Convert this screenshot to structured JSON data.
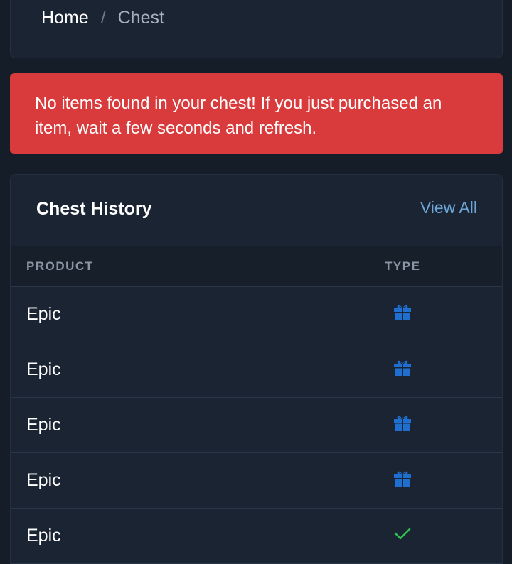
{
  "breadcrumb": {
    "home": "Home",
    "separator": "/",
    "current": "Chest"
  },
  "alert": {
    "message": "No items found in your chest! If you just purchased an item, wait a few seconds and refresh.",
    "color": "#d93a3b"
  },
  "history": {
    "title": "Chest History",
    "view_all": "View All",
    "columns": [
      "PRODUCT",
      "TYPE"
    ],
    "rows": [
      {
        "product": "Epic",
        "type_icon": "gift-icon"
      },
      {
        "product": "Epic",
        "type_icon": "gift-icon"
      },
      {
        "product": "Epic",
        "type_icon": "gift-icon"
      },
      {
        "product": "Epic",
        "type_icon": "gift-icon"
      },
      {
        "product": "Epic",
        "type_icon": "check-icon"
      }
    ]
  },
  "colors": {
    "gift": "#1e6fd0",
    "check": "#2fbf4f",
    "link": "#6ea6d8"
  }
}
